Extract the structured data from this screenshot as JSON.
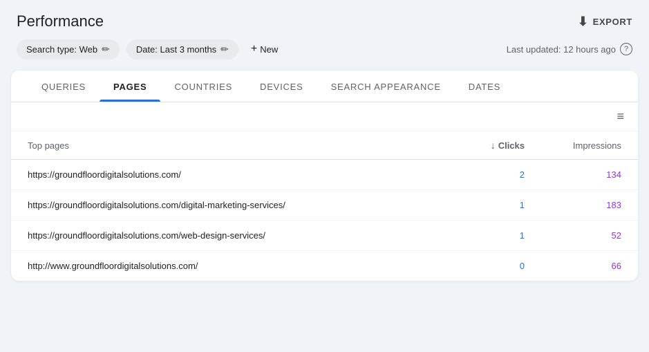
{
  "header": {
    "title": "Performance",
    "export_label": "EXPORT"
  },
  "filters": {
    "search_type_label": "Search type: Web",
    "date_label": "Date: Last 3 months",
    "new_label": "New",
    "last_updated": "Last updated: 12 hours ago"
  },
  "tabs": [
    {
      "id": "queries",
      "label": "QUERIES",
      "active": false
    },
    {
      "id": "pages",
      "label": "PAGES",
      "active": true
    },
    {
      "id": "countries",
      "label": "COUNTRIES",
      "active": false
    },
    {
      "id": "devices",
      "label": "DEVICES",
      "active": false
    },
    {
      "id": "search-appearance",
      "label": "SEARCH APPEARANCE",
      "active": false
    },
    {
      "id": "dates",
      "label": "DATES",
      "active": false
    }
  ],
  "table": {
    "col_page": "Top pages",
    "col_clicks": "Clicks",
    "col_impressions": "Impressions",
    "rows": [
      {
        "url": "https://groundfloordigitalsolutions.com/",
        "clicks": "2",
        "impressions": "134"
      },
      {
        "url": "https://groundfloordigitalsolutions.com/digital-marketing-services/",
        "clicks": "1",
        "impressions": "183"
      },
      {
        "url": "https://groundfloordigitalsolutions.com/web-design-services/",
        "clicks": "1",
        "impressions": "52"
      },
      {
        "url": "http://www.groundfloordigitalsolutions.com/",
        "clicks": "0",
        "impressions": "66"
      }
    ]
  },
  "icons": {
    "export": "⬇",
    "edit": "✏",
    "plus": "+",
    "help": "?",
    "sort_down": "↓",
    "filter": "≡"
  }
}
